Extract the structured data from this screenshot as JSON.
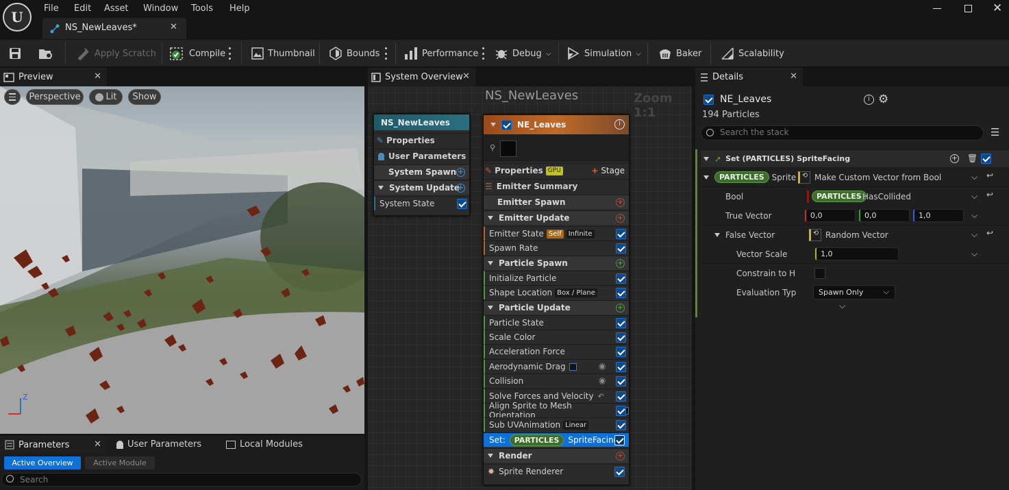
{
  "menu": [
    "File",
    "Edit",
    "Asset",
    "Window",
    "Tools",
    "Help"
  ],
  "document_tab": "NS_NewLeaves*",
  "toolbar": {
    "apply_scratch": "Apply Scratch",
    "compile": "Compile",
    "thumbnail": "Thumbnail",
    "bounds": "Bounds",
    "performance": "Performance",
    "debug": "Debug",
    "simulation": "Simulation",
    "baker": "Baker",
    "scalability": "Scalability"
  },
  "preview": {
    "tab": "Preview",
    "perspective": "Perspective",
    "lit": "Lit",
    "show": "Show",
    "axis_z": "Z"
  },
  "params": {
    "tabs": [
      "Parameters",
      "User Parameters",
      "Local Modules"
    ],
    "active_overview": "Active Overview",
    "active_module": "Active Module",
    "search_placeholder": "Search"
  },
  "graph": {
    "tab": "System Overview",
    "title": "NS_NewLeaves",
    "zoom": "Zoom 1:1"
  },
  "system_node": {
    "title": "NS_NewLeaves",
    "rows": [
      "Properties",
      "User Parameters",
      "System Spawn",
      "System Update",
      "System State"
    ]
  },
  "emitter_node": {
    "title": "NE_Leaves",
    "properties": "Properties",
    "gpu": "GPU",
    "stage": "Stage",
    "summary": "Emitter Summary",
    "emitter_spawn": "Emitter Spawn",
    "emitter_update": "Emitter Update",
    "emitter_state": "Emitter State",
    "self": "Self",
    "infinite": "Infinite",
    "spawn_rate": "Spawn Rate",
    "particle_spawn": "Particle Spawn",
    "initialize_particle": "Initialize Particle",
    "shape_location": "Shape Location",
    "box_plane": "Box / Plane",
    "particle_update": "Particle Update",
    "particle_state": "Particle State",
    "scale_color": "Scale Color",
    "acceleration_force": "Acceleration Force",
    "aerodynamic_drag": "Aerodynamic Drag",
    "collision": "Collision",
    "solve_forces": "Solve Forces and Velocity",
    "align_sprite": "Align Sprite to Mesh Orientation",
    "sub_uv": "Sub UVAnimation",
    "linear": "Linear",
    "set": "Set:",
    "particles": "PARTICLES",
    "sprite_facing": "SpriteFacing",
    "render": "Render",
    "sprite_renderer": "Sprite Renderer"
  },
  "details": {
    "tab": "Details",
    "emitter": "NE_Leaves",
    "particles_count": "194 Particles",
    "search_placeholder": "Search the stack",
    "section": "Set (PARTICLES) SpriteFacing",
    "sprite_label": "Sprite",
    "sprite_value": "Make Custom Vector from Bool",
    "bool_label": "Bool",
    "bool_value": "HasCollided",
    "true_vector": "True Vector",
    "tv": [
      "0,0",
      "0,0",
      "1,0"
    ],
    "false_vector": "False Vector",
    "false_value": "Random Vector",
    "vector_scale": "Vector Scale",
    "vs": "1,0",
    "constrain": "Constrain to H",
    "evaluation": "Evaluation Typ",
    "spawn_only": "Spawn Only"
  }
}
